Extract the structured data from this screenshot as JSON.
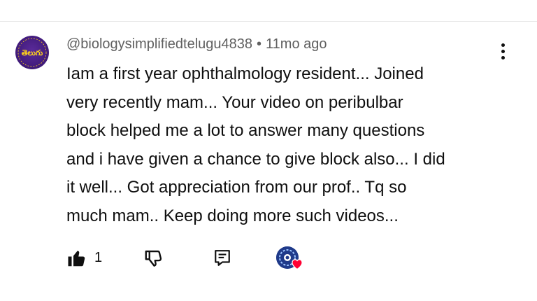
{
  "comment": {
    "avatar_text": "తెలుగు",
    "avatar_ring_text": "BIOLOGY SIMPLIFIED",
    "author": "@biologysimplifiedtelugu4838",
    "separator": "•",
    "timestamp": "11mo ago",
    "lines": [
      "Iam a first year ophthalmology resident... Joined",
      "very recently mam... Your video on peribulbar",
      "block helped me a lot to answer many questions",
      "and i have given a chance to give block also... I did",
      "it well... Got appreciation from our prof.. Tq so",
      "much mam.. Keep doing more such videos..."
    ]
  },
  "actions": {
    "like_count": "1",
    "like_icon": "thumb-up-filled-icon",
    "dislike_icon": "thumb-down-icon",
    "reply_icon": "reply-comment-icon",
    "hearted_icon": "creator-heart-icon"
  },
  "colors": {
    "text": "#0f0f0f",
    "meta": "#606060",
    "heart": "#ff0033",
    "avatar_bg": "#3f1a78",
    "avatar_text": "#ffd21a"
  }
}
